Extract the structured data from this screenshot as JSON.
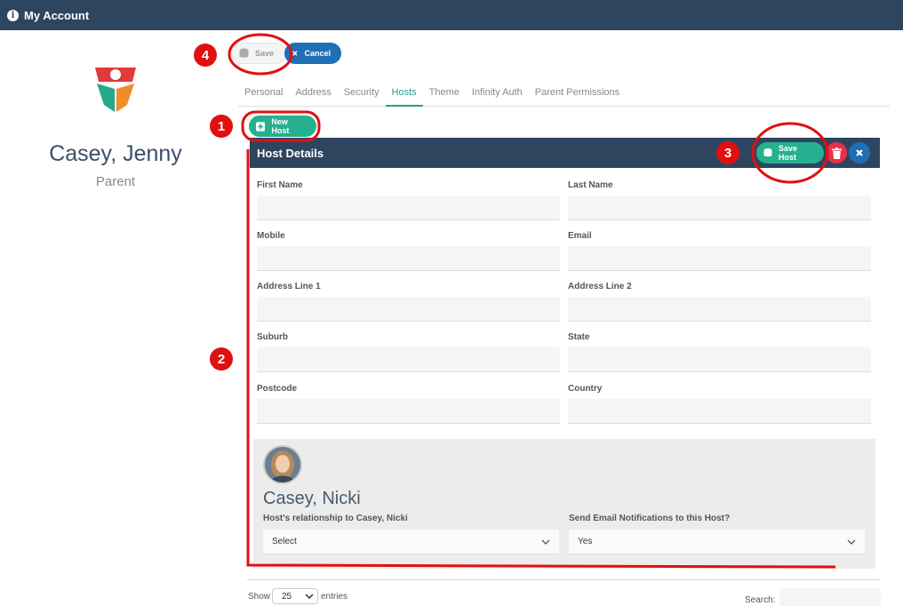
{
  "app": {
    "title": "My Account"
  },
  "profile": {
    "name": "Casey, Jenny",
    "role": "Parent"
  },
  "toolbar": {
    "save_label": "Save",
    "cancel_label": "Cancel"
  },
  "tabs": [
    {
      "label": "Personal"
    },
    {
      "label": "Address"
    },
    {
      "label": "Security"
    },
    {
      "label": "Hosts",
      "active": true
    },
    {
      "label": "Theme"
    },
    {
      "label": "Infinity Auth"
    },
    {
      "label": "Parent Permissions"
    }
  ],
  "hosts": {
    "new_host_label": "New Host",
    "panel_title": "Host Details",
    "save_host_label": "Save Host",
    "fields": {
      "first_name": {
        "label": "First Name",
        "value": ""
      },
      "last_name": {
        "label": "Last Name",
        "value": ""
      },
      "mobile": {
        "label": "Mobile",
        "value": ""
      },
      "email": {
        "label": "Email",
        "value": ""
      },
      "address1": {
        "label": "Address Line 1",
        "value": ""
      },
      "address2": {
        "label": "Address Line 2",
        "value": ""
      },
      "suburb": {
        "label": "Suburb",
        "value": ""
      },
      "state": {
        "label": "State",
        "value": ""
      },
      "postcode": {
        "label": "Postcode",
        "value": ""
      },
      "country": {
        "label": "Country",
        "value": ""
      }
    },
    "child": {
      "name": "Casey, Nicki",
      "relationship_label": "Host's relationship to Casey, Nicki",
      "relationship_value": "Select",
      "notify_label": "Send Email Notifications to this Host?",
      "notify_value": "Yes"
    }
  },
  "table": {
    "show_label": "Show",
    "entries_value": "25",
    "entries_label": "entries",
    "search_label": "Search:"
  },
  "annotations": [
    "1",
    "2",
    "3",
    "4"
  ],
  "colors": {
    "header": "#2e4560",
    "accent": "#27b090",
    "primary": "#1f6fb5",
    "danger": "#e8304a",
    "annotation": "#e11010"
  }
}
